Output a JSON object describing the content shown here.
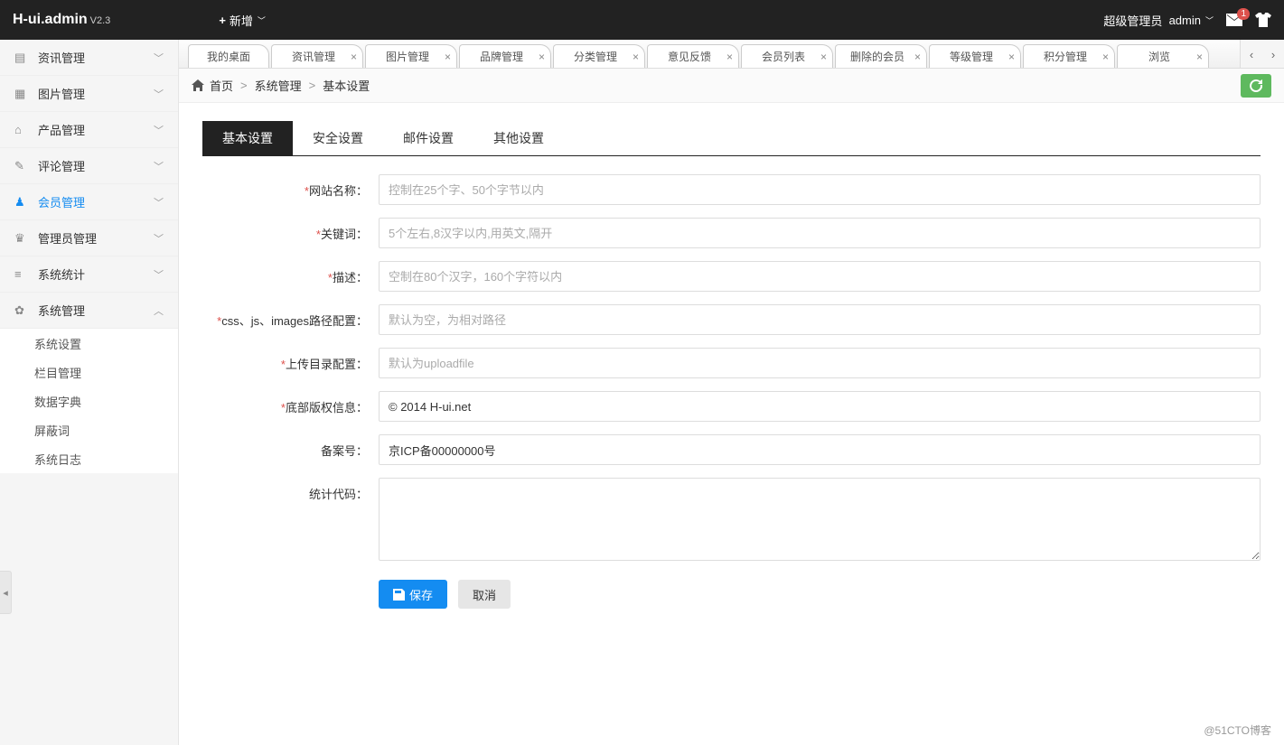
{
  "header": {
    "logo": "H-ui.admin",
    "version": "V2.3",
    "new_label": "新增",
    "user_role": "超级管理员",
    "user_name": "admin",
    "mail_badge": "1"
  },
  "sidebar": {
    "items": [
      {
        "icon": "news",
        "label": "资讯管理",
        "expanded": false
      },
      {
        "icon": "image",
        "label": "图片管理",
        "expanded": false
      },
      {
        "icon": "product",
        "label": "产品管理",
        "expanded": false
      },
      {
        "icon": "comment",
        "label": "评论管理",
        "expanded": false
      },
      {
        "icon": "member",
        "label": "会员管理",
        "expanded": false,
        "active": true
      },
      {
        "icon": "admin",
        "label": "管理员管理",
        "expanded": false
      },
      {
        "icon": "stats",
        "label": "系统统计",
        "expanded": false
      },
      {
        "icon": "system",
        "label": "系统管理",
        "expanded": true,
        "children": [
          "系统设置",
          "栏目管理",
          "数据字典",
          "屏蔽词",
          "系统日志"
        ]
      }
    ]
  },
  "tabs": [
    {
      "label": "我的桌面",
      "closable": false
    },
    {
      "label": "资讯管理",
      "closable": true
    },
    {
      "label": "图片管理",
      "closable": true
    },
    {
      "label": "品牌管理",
      "closable": true
    },
    {
      "label": "分类管理",
      "closable": true
    },
    {
      "label": "意见反馈",
      "closable": true
    },
    {
      "label": "会员列表",
      "closable": true
    },
    {
      "label": "删除的会员",
      "closable": true
    },
    {
      "label": "等级管理",
      "closable": true
    },
    {
      "label": "积分管理",
      "closable": true
    },
    {
      "label": "浏览",
      "closable": true
    }
  ],
  "breadcrumb": {
    "home": "首页",
    "level1": "系统管理",
    "level2": "基本设置"
  },
  "inner_tabs": [
    "基本设置",
    "安全设置",
    "邮件设置",
    "其他设置"
  ],
  "form": {
    "site_name": {
      "label": "网站名称：",
      "placeholder": "控制在25个字、50个字节以内",
      "required": true
    },
    "keywords": {
      "label": "关键词：",
      "placeholder": "5个左右,8汉字以内,用英文,隔开",
      "required": true
    },
    "description": {
      "label": "描述：",
      "placeholder": "空制在80个汉字，160个字符以内",
      "required": true
    },
    "path": {
      "label": "css、js、images路径配置：",
      "placeholder": "默认为空，为相对路径",
      "required": true
    },
    "upload": {
      "label": "上传目录配置：",
      "placeholder": "默认为uploadfile",
      "required": true
    },
    "copyright": {
      "label": "底部版权信息：",
      "value": "© 2014 H-ui.net",
      "required": true
    },
    "icp": {
      "label": "备案号：",
      "value": "京ICP备00000000号",
      "required": false
    },
    "stats_code": {
      "label": "统计代码：",
      "value": "",
      "required": false
    },
    "save": "保存",
    "cancel": "取消"
  },
  "watermark": "@51CTO博客"
}
